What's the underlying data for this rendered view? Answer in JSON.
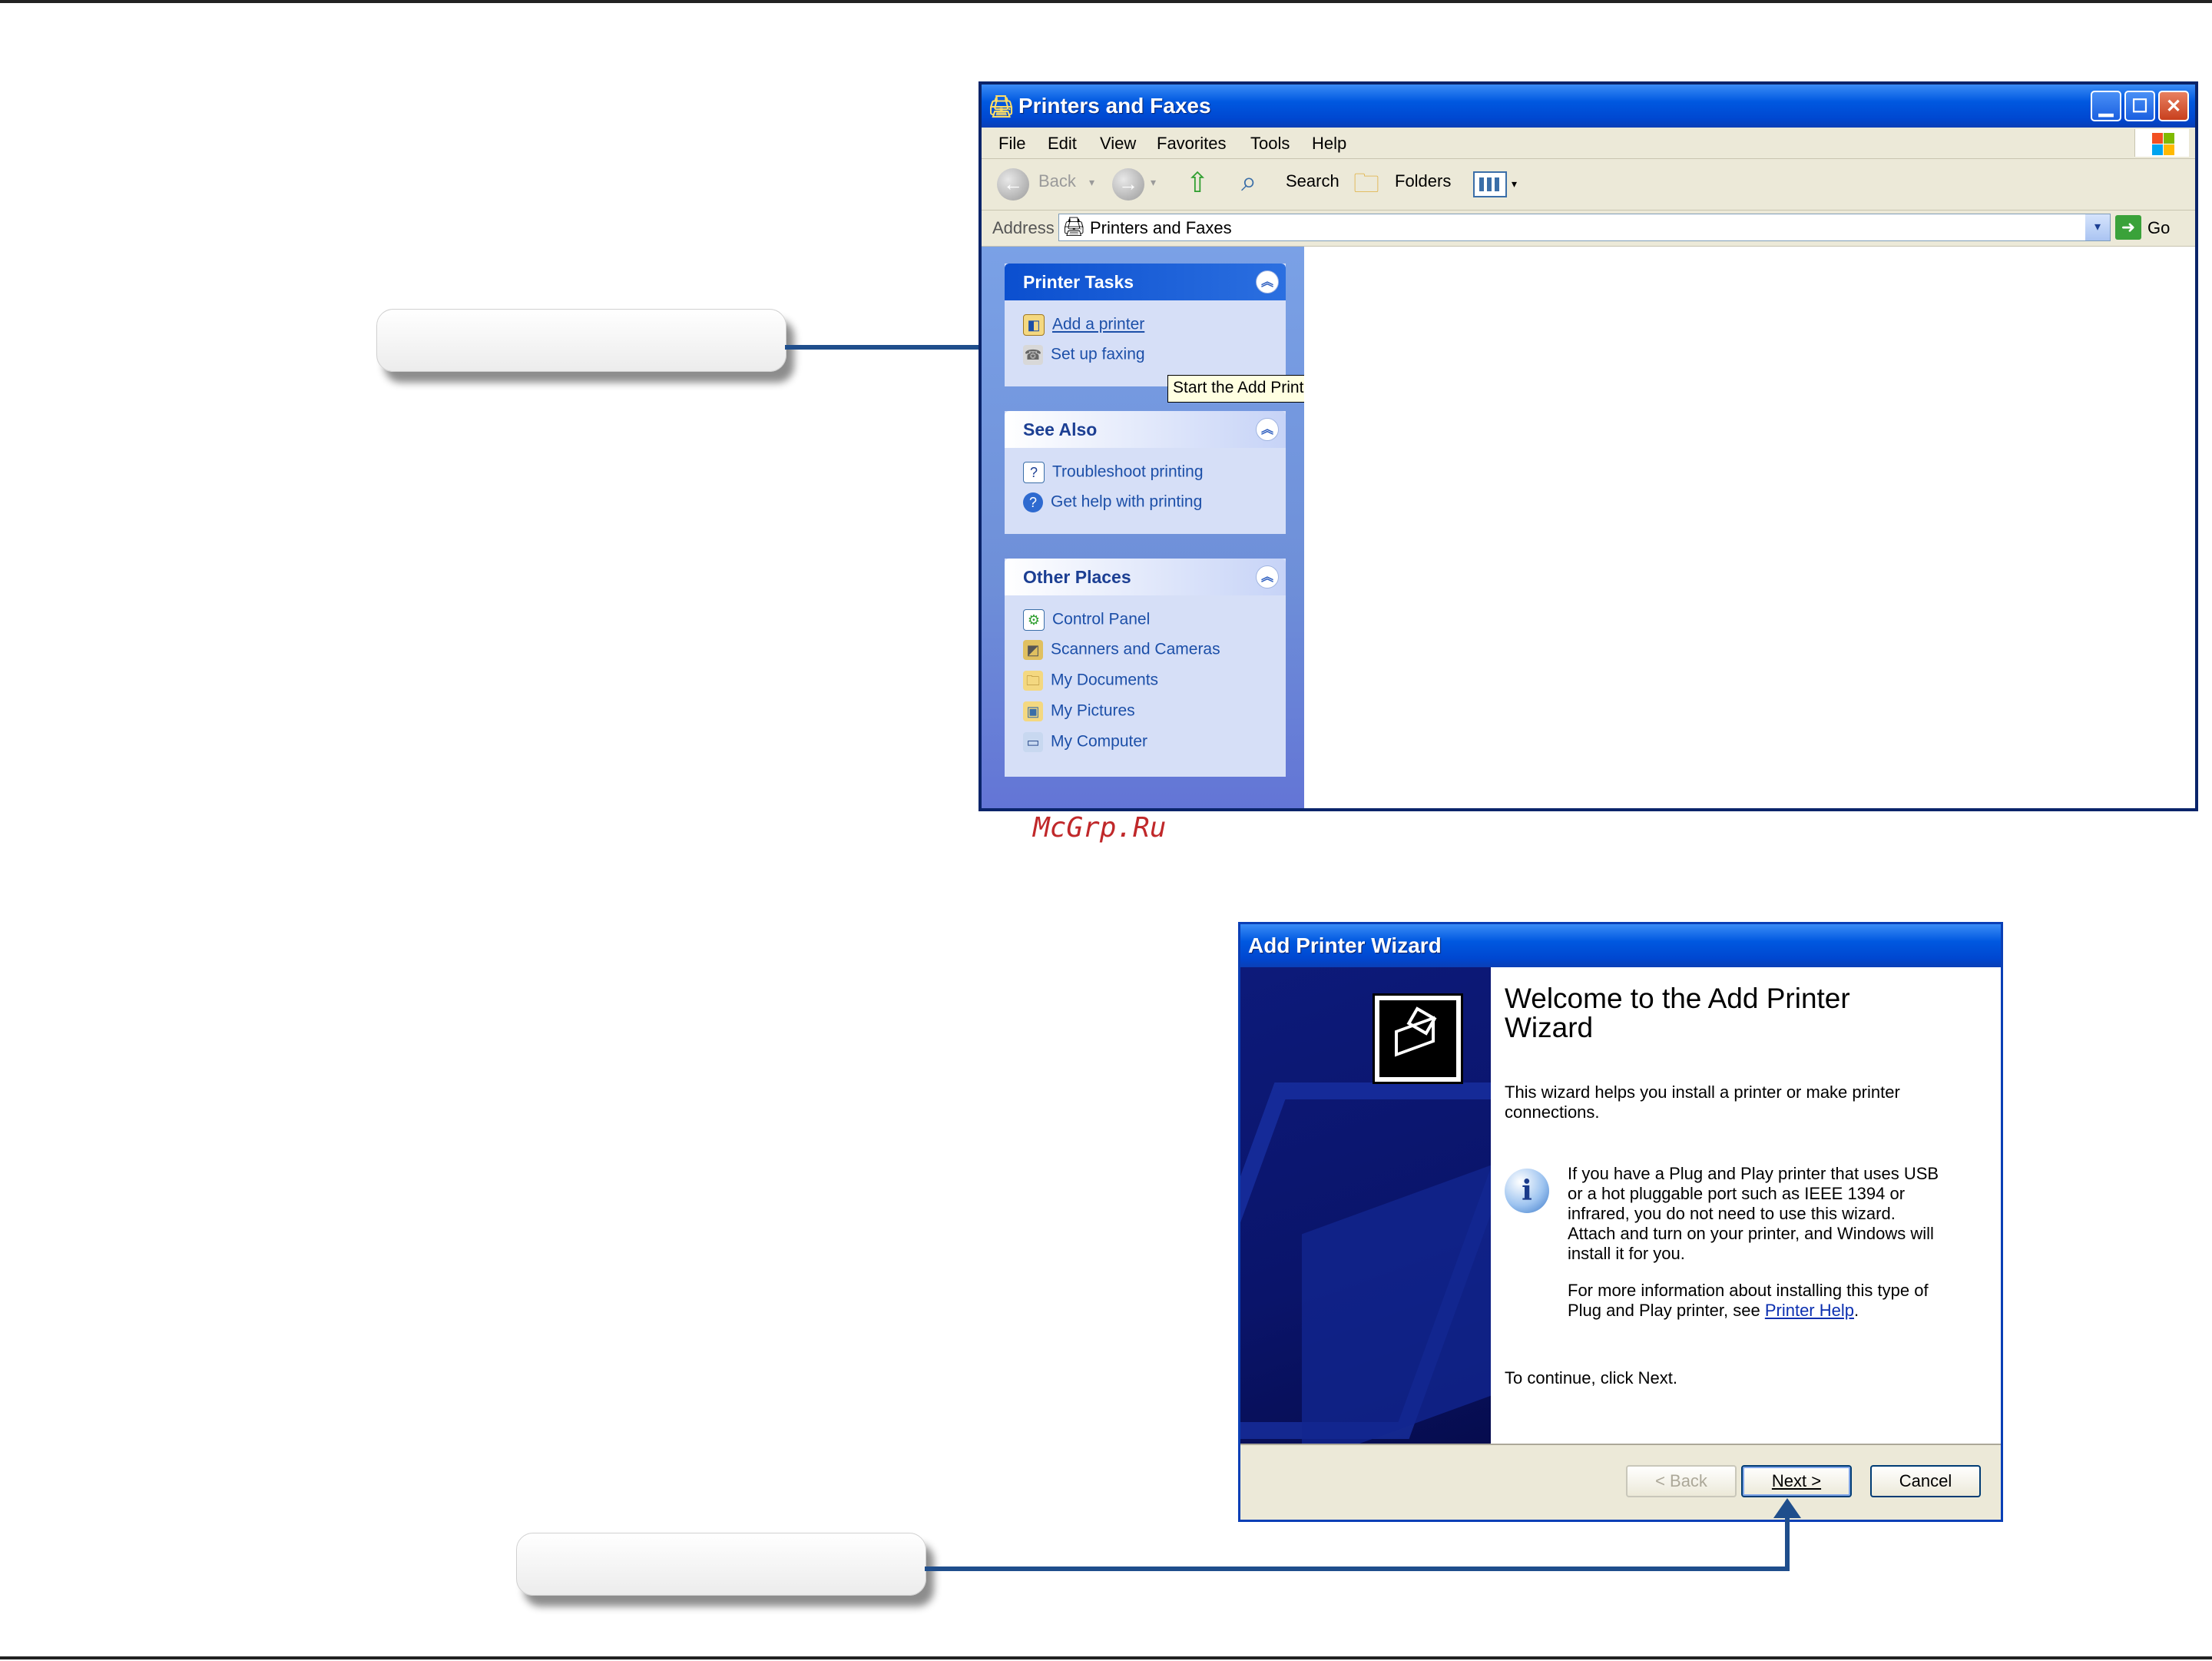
{
  "explorer": {
    "title": "Printers and Faxes",
    "menu": [
      "File",
      "Edit",
      "View",
      "Favorites",
      "Tools",
      "Help"
    ],
    "toolbar": {
      "back": "Back",
      "search": "Search",
      "folders": "Folders"
    },
    "address": {
      "label": "Address",
      "value": "Printers and Faxes",
      "go": "Go"
    },
    "printer_tasks": {
      "header": "Printer Tasks",
      "items": [
        "Add a printer",
        "Set up faxing"
      ]
    },
    "tooltip": "Start the Add Printer Wizard, which helps you install a printer.",
    "see_also": {
      "header": "See Also",
      "items": [
        "Troubleshoot printing",
        "Get help with printing"
      ]
    },
    "other_places": {
      "header": "Other Places",
      "items": [
        "Control Panel",
        "Scanners and Cameras",
        "My Documents",
        "My Pictures",
        "My Computer"
      ]
    }
  },
  "watermark": "McGrp.Ru",
  "wizard": {
    "title": "Add Printer Wizard",
    "heading": "Welcome to the Add Printer Wizard",
    "intro": "This wizard helps you install a printer or make printer connections.",
    "pnp_note": "If you have a Plug and Play printer that uses USB or a hot pluggable port such as IEEE 1394 or infrared, you do not need to use this wizard. Attach and turn on your printer, and Windows will install it for you.",
    "more_info_prefix": "For more information about installing this type of Plug and Play printer, see ",
    "more_info_link": "Printer Help",
    "more_info_suffix": ".",
    "continue": "To continue, click Next.",
    "buttons": {
      "back": "< Back",
      "next": "Next >",
      "cancel": "Cancel"
    }
  },
  "colors": {
    "connector": "#1f4e8c",
    "xp_blue": "#0058e0",
    "task_link": "#1c4fa8"
  }
}
